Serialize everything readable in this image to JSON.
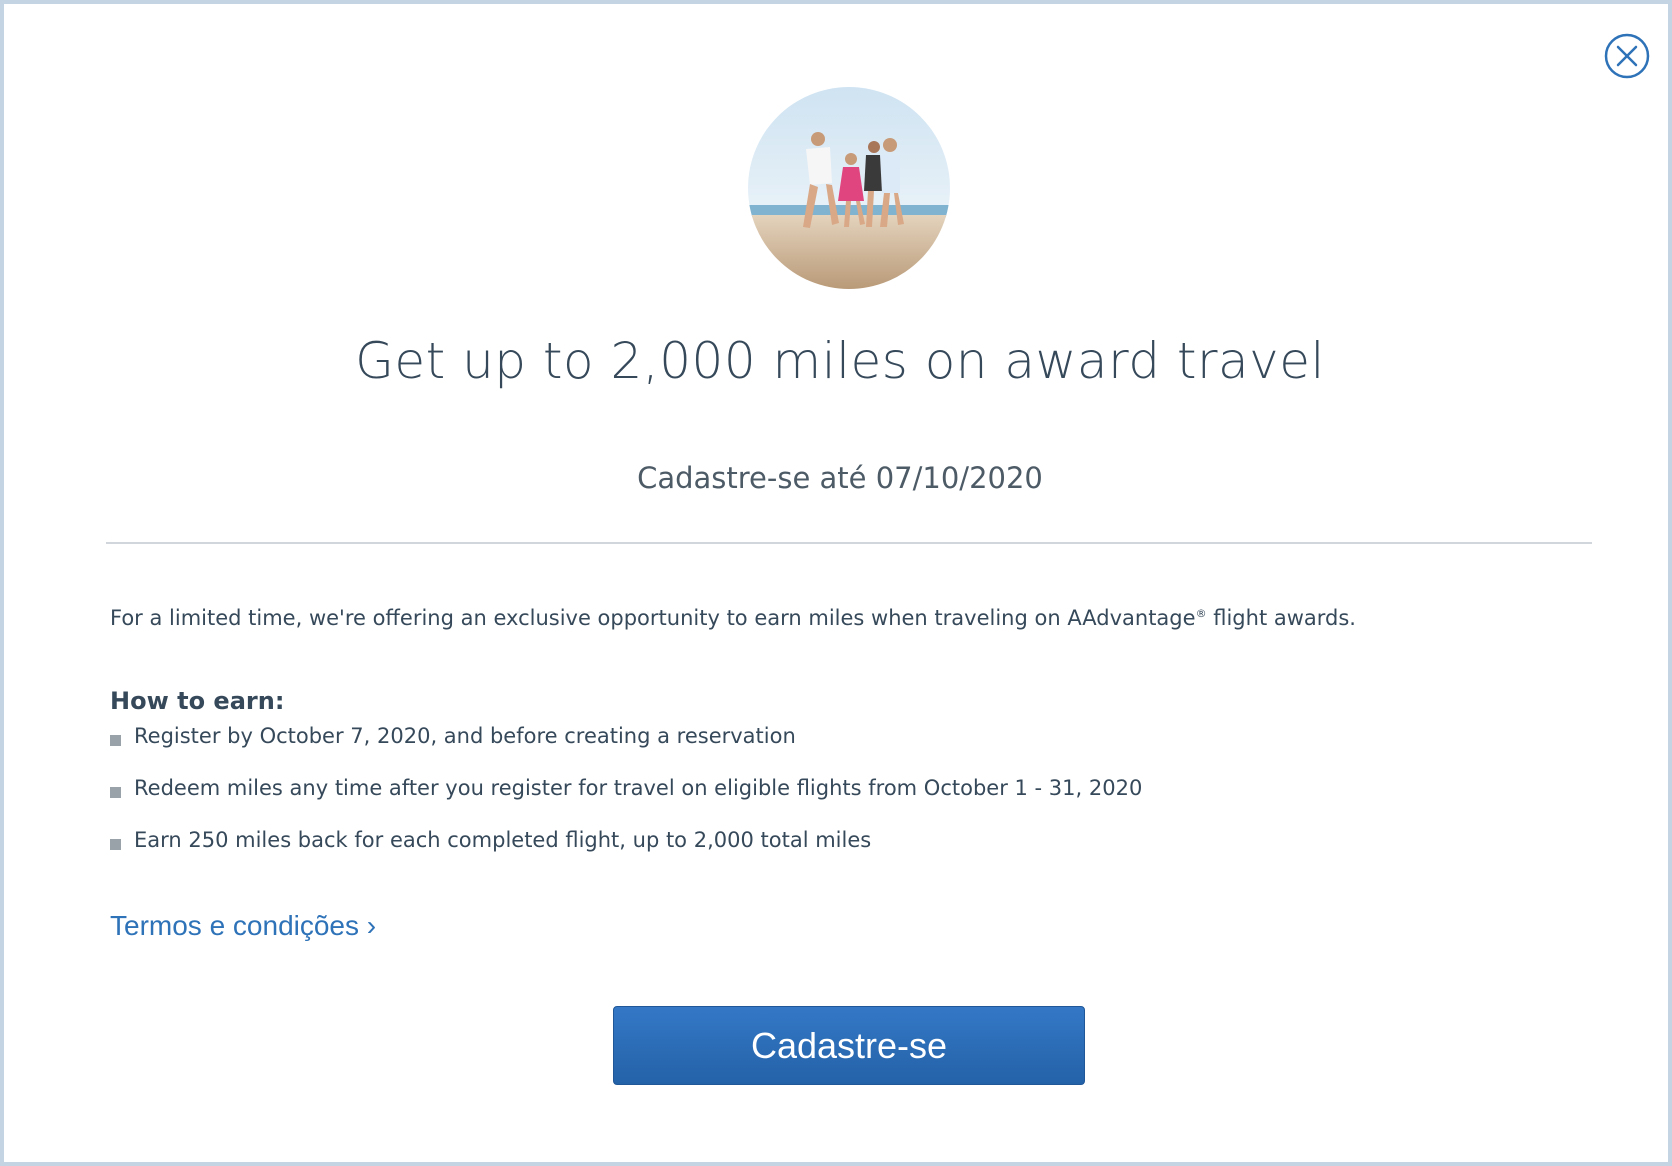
{
  "modal": {
    "title": "Get up to 2,000 miles on award travel",
    "subtitle": "Cadastre-se até 07/10/2020",
    "intro_text": "For a limited time, we're offering an exclusive opportunity to earn miles when traveling on AAdvantage",
    "intro_registered_mark": "®",
    "intro_text_end": " flight awards.",
    "how_to_heading": "How to earn:",
    "steps": [
      "Register by October 7, 2020, and before creating a reservation",
      "Redeem miles any time after you register for travel on eligible flights from October 1 - 31, 2020",
      "Earn 250 miles back for each completed flight, up to 2,000 total miles"
    ],
    "terms_link": "Termos e condições ›",
    "register_button": "Cadastre-se",
    "close_icon": "close-icon",
    "hero_image": "family-on-beach-photo"
  },
  "colors": {
    "accent": "#2e72b8",
    "button": "#2d6fbc",
    "text": "#36495a",
    "divider": "#d0d6dc",
    "frame_border": "#c5d4e3"
  }
}
